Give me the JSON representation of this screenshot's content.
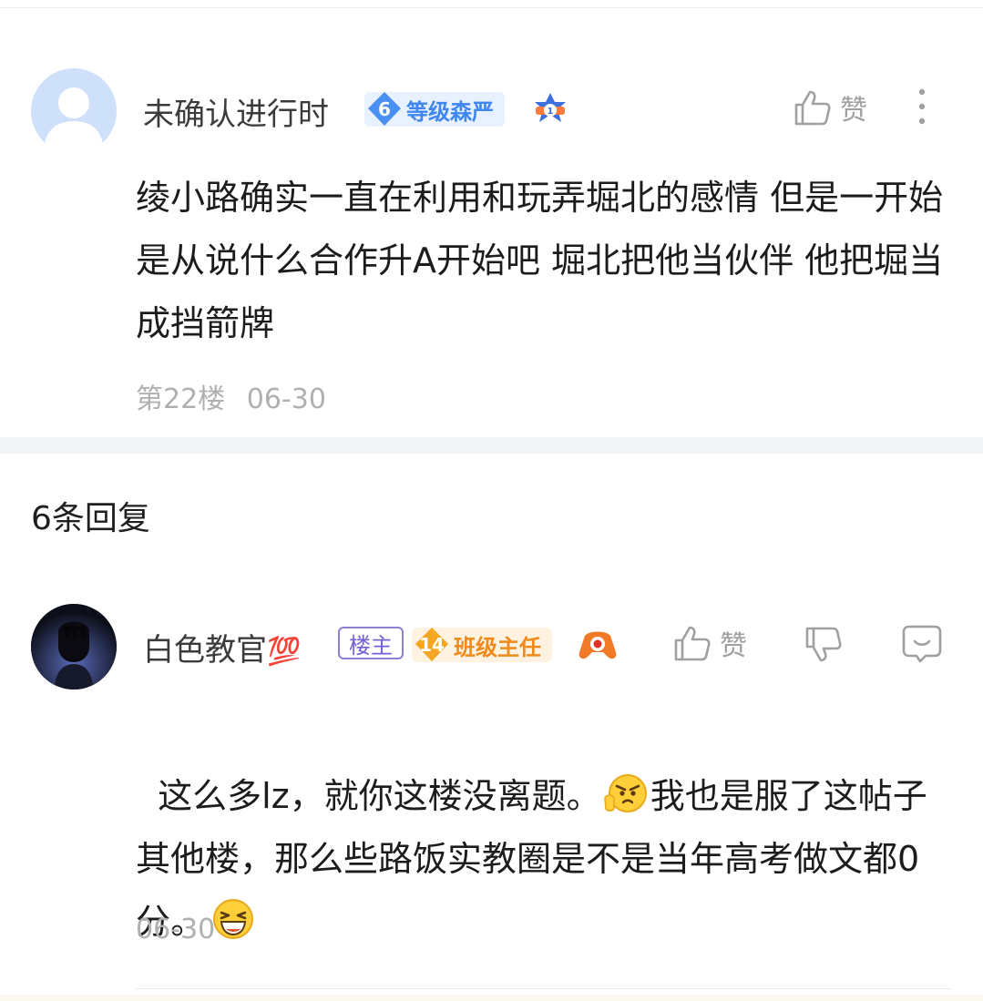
{
  "post": {
    "username": "未确认进行时",
    "level_num": "6",
    "level_title": "等级森严",
    "like_label": "赞",
    "content": "绫小路确实一直在利用和玩弄堀北的感情 但是一开始是从说什么合作升A开始吧 堀北把他当伙伴 他把堀当成挡箭牌",
    "floor": "第22楼",
    "date": "06-30",
    "icons": [
      "avatar-placeholder-icon",
      "rank-1-medal-icon",
      "thumbs-up-icon",
      "more-vertical-icon"
    ]
  },
  "replies_header": "6条回复",
  "reply": {
    "username": "白色教官",
    "emoji_badge": "💯",
    "owner_tag": "楼主",
    "level_num": "14",
    "level_title": "班级主任",
    "like_label": "赞",
    "content_parts": [
      "这么多lz，就你这楼没离题。",
      "我也是服了这帖子其他楼，那么些路饭实教圈是不是当年高考做文都0分。"
    ],
    "date": "06-30",
    "icons": [
      "avatar-dark-figure-icon",
      "game-controller-icon",
      "thumbs-up-icon",
      "thumbs-down-icon",
      "comment-icon",
      "angry-emoji-icon",
      "grin-emoji-icon"
    ]
  },
  "colors": {
    "level_blue_bg": "#e8f1ff",
    "level_blue_text": "#3f86f0",
    "level_orange_bg": "#fff2e0",
    "level_orange_text": "#f08a1a",
    "owner_tag": "#7560d6"
  }
}
